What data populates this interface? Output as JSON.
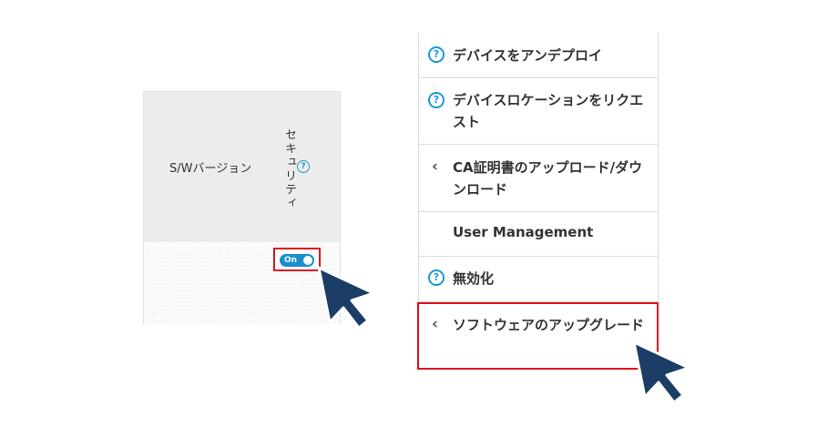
{
  "table": {
    "columns": {
      "sw_version": "S/Wバージョン",
      "security": "セキュリティ"
    },
    "help_icon_glyph": "?",
    "toggle": {
      "label": "On",
      "state": "on"
    }
  },
  "menu": {
    "items": [
      {
        "icon": "help-icon",
        "glyph": "?",
        "label": "デバイスをアンデプロイ"
      },
      {
        "icon": "help-icon",
        "glyph": "?",
        "label": "デバイスロケーションをリクエスト"
      },
      {
        "icon": "chevron-left-icon",
        "glyph": "‹",
        "label": "CA証明書のアップロード/ダウンロード"
      },
      {
        "icon": "none",
        "glyph": "",
        "label": "User Management"
      },
      {
        "icon": "help-icon",
        "glyph": "?",
        "label": "無効化"
      },
      {
        "icon": "chevron-left-icon",
        "glyph": "‹",
        "label": "ソフトウェアのアップグレード"
      }
    ]
  },
  "colors": {
    "highlight": "#e0131d",
    "accent": "#1a8fd0",
    "cursor": "#1b3d66"
  }
}
